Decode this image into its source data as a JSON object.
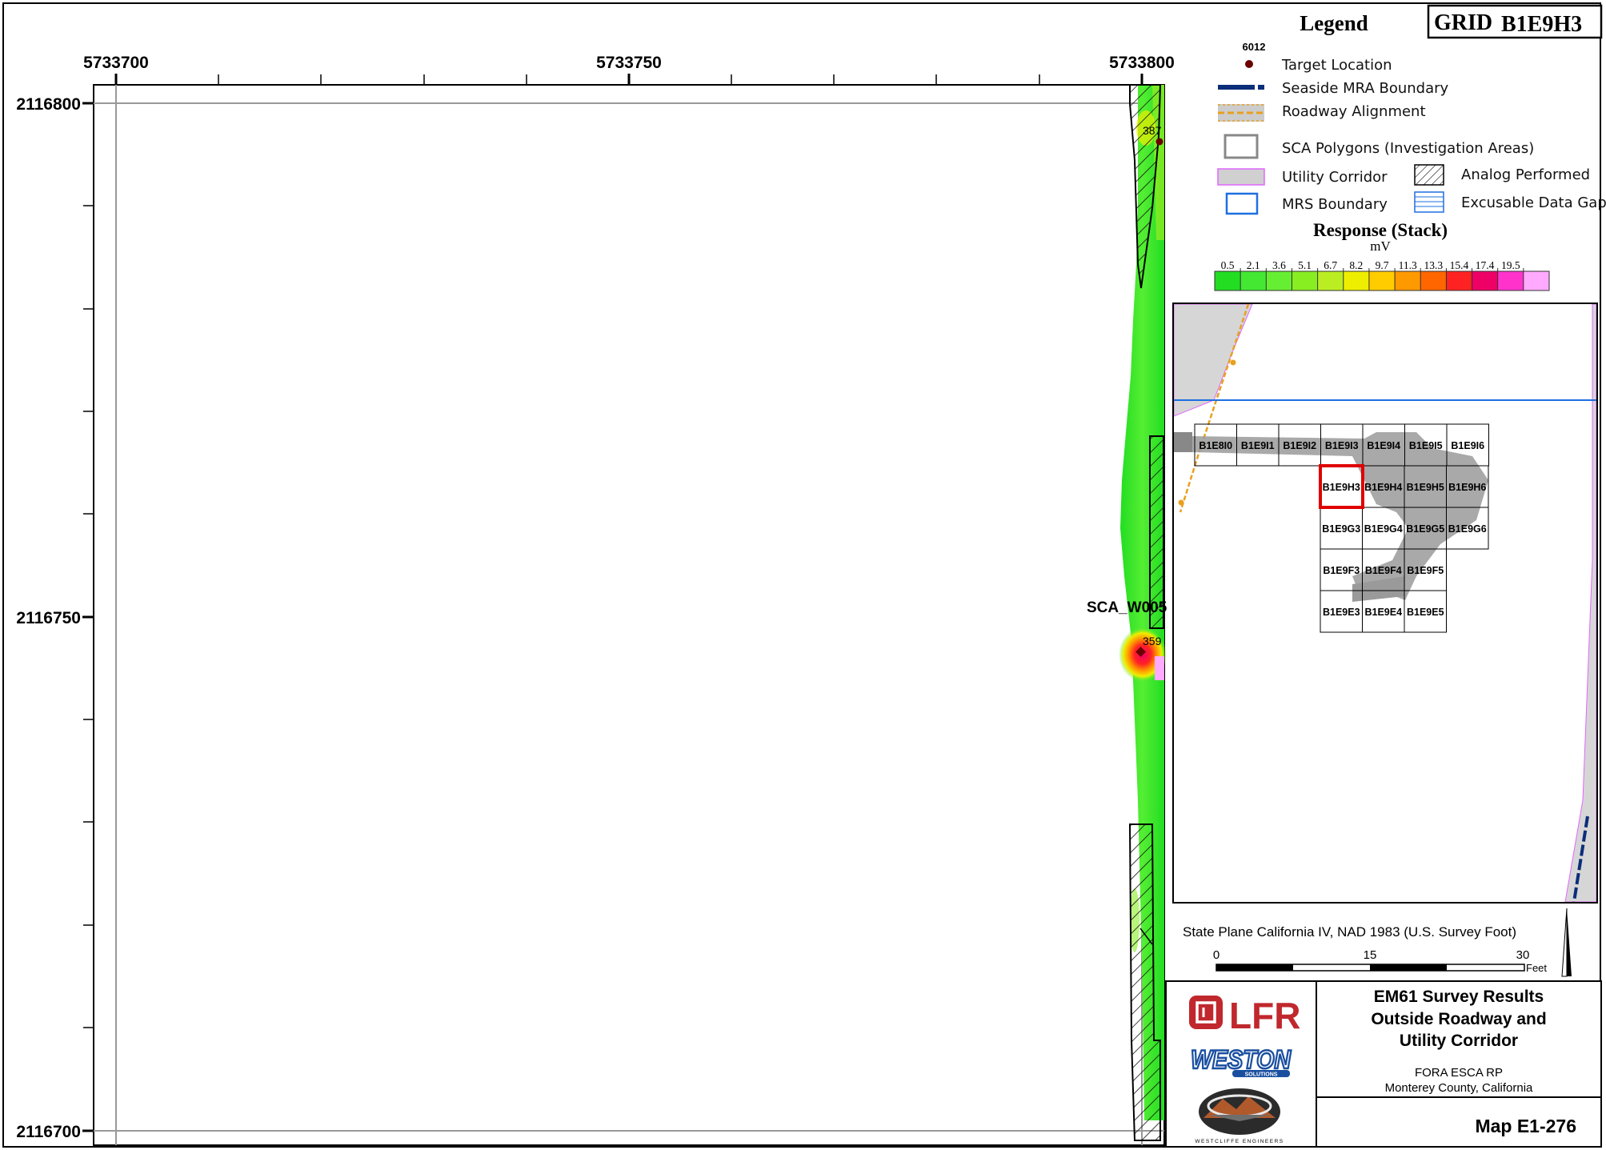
{
  "map": {
    "x_ticks": [
      "5733700",
      "5733750",
      "5733800"
    ],
    "y_ticks": [
      "2116800",
      "2116750",
      "2116700"
    ],
    "target_labels": [
      "387",
      "359"
    ],
    "sca_label": "SCA_W005"
  },
  "legend": {
    "title": "Legend",
    "grid_prefix": "GRID",
    "grid_id": "B1E9H3",
    "target_id": "6012",
    "items": {
      "target": "Target Location",
      "mra": "Seaside MRA Boundary",
      "road": "Roadway Alignment",
      "sca": "SCA Polygons (Investigation Areas)",
      "utility": "Utility Corridor",
      "analog": "Analog Performed",
      "mrs": "MRS Boundary",
      "gap": "Excusable Data Gap"
    },
    "response_title": "Response (Stack)",
    "response_unit": "mV",
    "scale_values": [
      "0.5",
      "2.1",
      "3.6",
      "5.1",
      "6.7",
      "8.2",
      "9.7",
      "11.3",
      "13.3",
      "15.4",
      "17.4",
      "19.5"
    ],
    "colors": [
      "#22dd22",
      "#44e833",
      "#66ee33",
      "#88ee22",
      "#bbee22",
      "#eeee00",
      "#ffcc00",
      "#ff9900",
      "#ff6600",
      "#ff2222",
      "#ee0066",
      "#ff33cc",
      "#ffaaff"
    ]
  },
  "inset": {
    "grid_rows": [
      [
        "B1E8I0",
        "B1E9I1",
        "B1E9I2",
        "B1E9I3",
        "B1E9I4",
        "B1E9I5",
        "B1E9I6"
      ],
      [
        "B1E9H3",
        "B1E9H4",
        "B1E9H5",
        "B1E9H6"
      ],
      [
        "B1E9G3",
        "B1E9G4",
        "B1E9G5",
        "B1E9G6"
      ],
      [
        "B1E9F3",
        "B1E9F4",
        "B1E9F5"
      ],
      [
        "B1E9E3",
        "B1E9E4",
        "B1E9E5"
      ]
    ],
    "highlight": "B1E9H3"
  },
  "scalebar": {
    "projection": "State Plane California IV, NAD 1983 (U.S. Survey Foot)",
    "labels": [
      "0",
      "15",
      "30"
    ],
    "unit": "Feet"
  },
  "title_block": {
    "title_lines": [
      "EM61 Survey Results",
      "Outside Roadway and",
      "Utility Corridor"
    ],
    "project": "FORA ESCA RP",
    "location": "Monterey County, California",
    "map_no": "Map E1-276",
    "logo_lfr": "LFR",
    "logo_weston": "WESTON",
    "logo_weston_sub": "SOLUTIONS",
    "logo_westcliffe": "WESTCLIFFE ENGINEERS"
  }
}
